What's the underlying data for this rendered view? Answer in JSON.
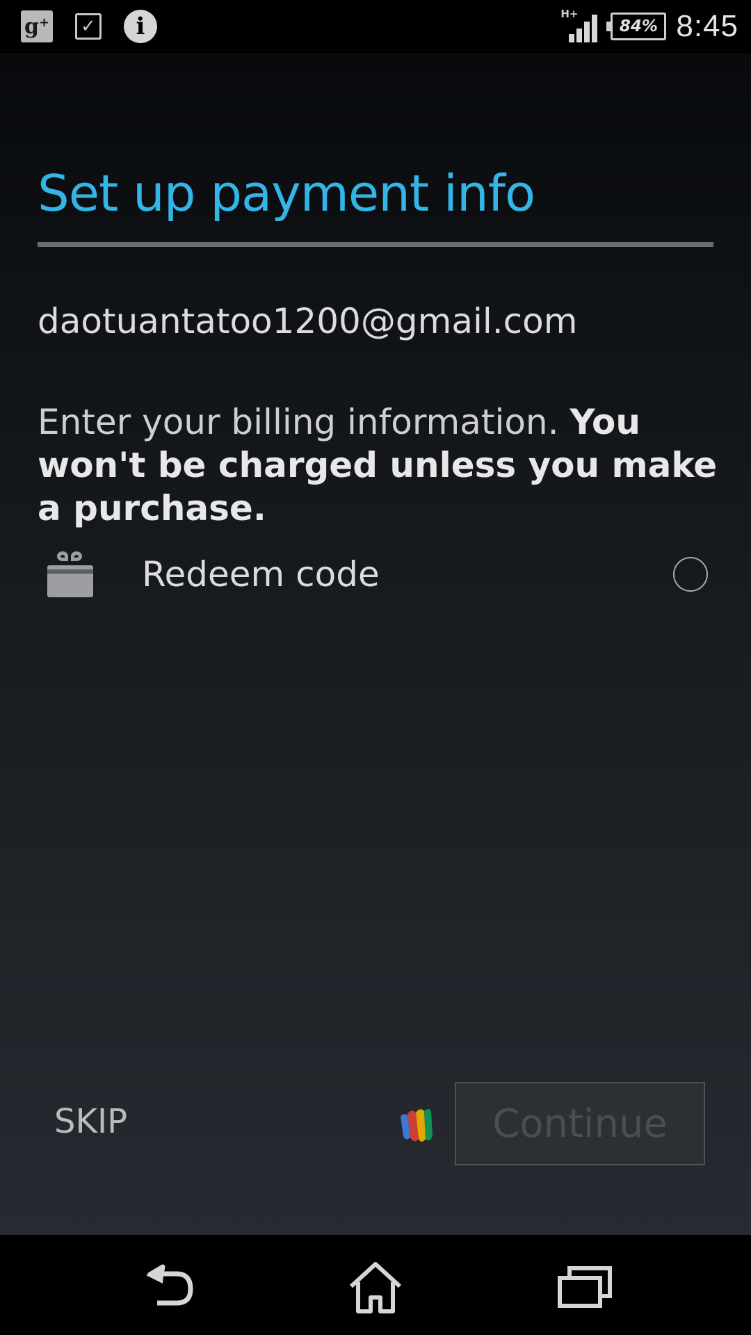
{
  "status_bar": {
    "left_icons": [
      "google-plus-icon",
      "task-check-icon",
      "info-icon"
    ],
    "gplus_label": "g",
    "gplus_plus": "+",
    "check_glyph": "✓",
    "info_glyph": "i",
    "network_type": "H+",
    "battery_percent": "84%",
    "battery_level": 0.84,
    "time": "8:45"
  },
  "page": {
    "title": "Set up payment info",
    "account_email": "daotuantatoo1200@gmail.com",
    "billing_text_regular": "Enter your billing information. ",
    "billing_text_emphasis": "You won't be charged unless you make a purchase."
  },
  "options": {
    "redeem": {
      "icon": "gift-icon",
      "label": "Redeem code",
      "selected": false
    }
  },
  "actions": {
    "skip_label": "SKIP",
    "wallet_icon": "google-wallet-icon",
    "continue_label": "Continue",
    "continue_enabled": false
  },
  "nav_bar": {
    "buttons": [
      "back-icon",
      "home-icon",
      "recent-apps-icon"
    ]
  },
  "colors": {
    "accent": "#33b5e5",
    "background_top": "#080a0c",
    "background_bottom": "#272b31",
    "wallet_blue": "#4285f4",
    "wallet_red": "#db4437",
    "wallet_yellow": "#f4b400",
    "wallet_green": "#0f9d58"
  }
}
